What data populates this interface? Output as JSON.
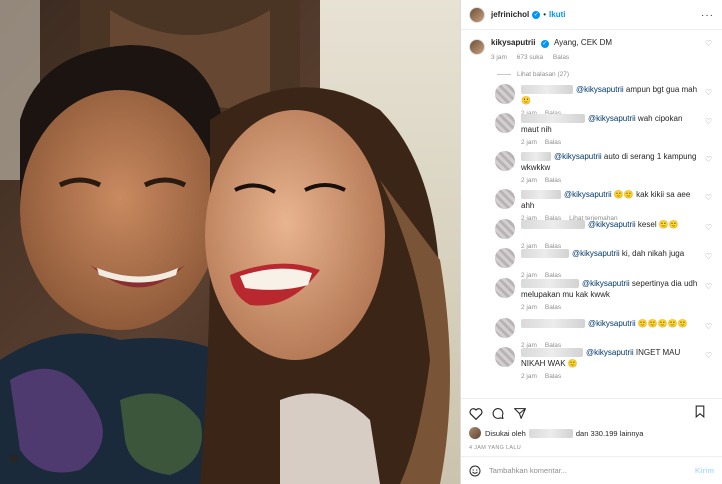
{
  "header": {
    "username": "jefrinichol",
    "separator": "•",
    "follow_label": "Ikuti",
    "more_label": "···"
  },
  "caption": {
    "username": "kikysaputrii",
    "text": "Ayang, CEK DM",
    "time": "3 jam",
    "likes": "673 suka",
    "reply_label": "Balas"
  },
  "view_replies": "Lihat balasan (27)",
  "replies": [
    {
      "mention": "@kikysaputrii",
      "text": "ampun bgt gua mah🙂",
      "time": "2 jam",
      "reply": "Balas",
      "extra": ""
    },
    {
      "mention": "@kikysaputrii",
      "text": "wah cipokan maut nih",
      "time": "2 jam",
      "reply": "Balas",
      "extra": ""
    },
    {
      "mention": "@kikysaputrii",
      "text": "auto di serang 1 kampung wkwkkw",
      "time": "2 jam",
      "reply": "Balas",
      "extra": ""
    },
    {
      "mention": "@kikysaputrii",
      "text": "🙂🙂 kak kikii sa aee ahh",
      "time": "2 jam",
      "reply": "Balas",
      "extra": "Lihat terjemahan"
    },
    {
      "mention": "@kikysaputrii",
      "text": "kesel 🙂🙂",
      "time": "2 jam",
      "reply": "Balas",
      "extra": ""
    },
    {
      "mention": "@kikysaputrii",
      "text": "ki, dah nikah juga",
      "time": "2 jam",
      "reply": "Balas",
      "extra": ""
    },
    {
      "mention": "@kikysaputrii",
      "text": "sepertinya dia udh melupakan mu kak kwwk",
      "time": "2 jam",
      "reply": "Balas",
      "extra": ""
    },
    {
      "mention": "@kikysaputrii",
      "text": "🙂🙂🙂🙂🙂",
      "time": "2 jam",
      "reply": "Balas",
      "extra": ""
    },
    {
      "mention": "@kikysaputrii",
      "text": "INGET MAU NIKAH WAK 🙂",
      "time": "2 jam",
      "reply": "Balas",
      "extra": ""
    }
  ],
  "likes": {
    "prefix": "Disukai oleh",
    "suffix": "dan 330.199 lainnya"
  },
  "time_ago": "4 JAM YANG LALU",
  "add_comment": {
    "placeholder": "Tambahkan komentar...",
    "post_label": "Kirim"
  },
  "colors": {
    "link_blue": "#0095f6",
    "mention": "#00376b",
    "muted": "#8e8e8e"
  }
}
